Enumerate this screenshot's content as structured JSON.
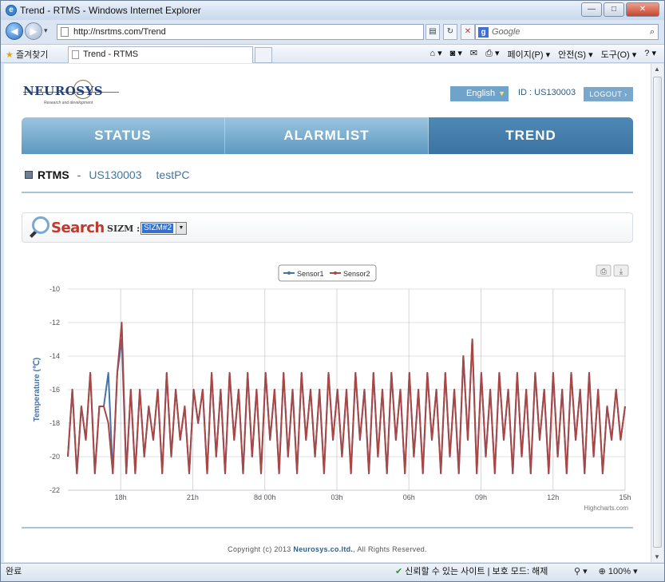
{
  "browser": {
    "title": "Trend - RTMS - Windows Internet Explorer",
    "url": "http://nsrtms.com/Trend",
    "search_placeholder": "Google",
    "favorites_label": "즐겨찾기",
    "tab_title": "Trend - RTMS",
    "commands": [
      "페이지(P) ▾",
      "안전(S) ▾",
      "도구(O) ▾"
    ],
    "status_left": "완료",
    "status_middle": "신뢰할 수 있는 사이트 | 보호 모드: 해제",
    "zoom": "100%"
  },
  "header": {
    "logo_text": "NEUROSYS",
    "logo_sub": "Research and development",
    "language": "English",
    "id_text": "ID : US130003",
    "logout_label": "LOGOUT"
  },
  "menu": {
    "items": [
      {
        "label": "STATUS",
        "active": false
      },
      {
        "label": "ALARMLIST",
        "active": false
      },
      {
        "label": "TREND",
        "active": true
      }
    ]
  },
  "breadcrumb": {
    "title": "RTMS",
    "sep": "-",
    "id": "US130003",
    "pc": "testPC"
  },
  "search": {
    "title": "Search",
    "sizm_label": "SIZM :",
    "sizm_value": "SIZM#2"
  },
  "footer": {
    "prefix": "Copyright (c) 2013 ",
    "company": "Neurosys.co.ltd.",
    "suffix": ", All Rights Reserved."
  },
  "chart_data": {
    "type": "line",
    "ylabel": "Temperature (℃)",
    "ylim": [
      -22,
      -10
    ],
    "yticks": [
      -10,
      -12,
      -14,
      -16,
      -18,
      -20,
      -22
    ],
    "xtick_labels": [
      "18h",
      "21h",
      "8d 00h",
      "03h",
      "06h",
      "09h",
      "12h",
      "15h"
    ],
    "xlim_hours": [
      15.8,
      39.0
    ],
    "xtick_hours": [
      18,
      21,
      24,
      27,
      30,
      33,
      36,
      39
    ],
    "credits": "Highcharts.com",
    "grid": "vertical",
    "legend_position": "top-center",
    "colors": {
      "Sensor1": "#4572a7",
      "Sensor2": "#aa4643"
    },
    "series": [
      {
        "name": "Sensor1",
        "values": [
          -20,
          -16,
          -21,
          -17,
          -19,
          -15,
          -21,
          -17,
          -17,
          -15,
          -21,
          -15,
          -13,
          -21,
          -16,
          -21,
          -16,
          -20,
          -17,
          -19,
          -16,
          -21,
          -15,
          -20,
          -16,
          -19,
          -17,
          -21,
          -16,
          -18,
          -16,
          -21,
          -15,
          -20,
          -16,
          -21,
          -15,
          -19,
          -16,
          -21,
          -15,
          -20,
          -16,
          -21,
          -15,
          -19,
          -16,
          -21,
          -15,
          -20,
          -16,
          -21,
          -15,
          -19,
          -16,
          -20,
          -16,
          -21,
          -15,
          -19,
          -16,
          -20,
          -16,
          -21,
          -15,
          -19,
          -16,
          -21,
          -15,
          -20,
          -16,
          -21,
          -15,
          -19,
          -16,
          -21,
          -15,
          -20,
          -16,
          -21,
          -15,
          -19,
          -16,
          -21,
          -15,
          -20,
          -16,
          -21,
          -14,
          -19,
          -13,
          -21,
          -15,
          -20,
          -16,
          -21,
          -15,
          -19,
          -16,
          -21,
          -15,
          -20,
          -16,
          -21,
          -15,
          -19,
          -16,
          -21,
          -15,
          -20,
          -16,
          -21,
          -15,
          -19,
          -16,
          -21,
          -15,
          -20,
          -16,
          -21,
          -17,
          -19,
          -16,
          -19,
          -17
        ]
      },
      {
        "name": "Sensor2",
        "values": [
          -20,
          -16,
          -21,
          -17,
          -19,
          -15,
          -21,
          -17,
          -17,
          -18,
          -21,
          -15,
          -12,
          -21,
          -16,
          -21,
          -16,
          -20,
          -17,
          -19,
          -16,
          -21,
          -15,
          -20,
          -16,
          -19,
          -17,
          -21,
          -16,
          -18,
          -16,
          -21,
          -15,
          -20,
          -16,
          -21,
          -15,
          -19,
          -16,
          -21,
          -15,
          -20,
          -16,
          -21,
          -15,
          -19,
          -16,
          -21,
          -15,
          -20,
          -16,
          -21,
          -15,
          -19,
          -16,
          -20,
          -16,
          -21,
          -15,
          -19,
          -16,
          -20,
          -16,
          -21,
          -15,
          -19,
          -16,
          -21,
          -15,
          -20,
          -16,
          -21,
          -15,
          -19,
          -16,
          -21,
          -15,
          -20,
          -16,
          -21,
          -15,
          -19,
          -16,
          -21,
          -15,
          -20,
          -16,
          -21,
          -14,
          -19,
          -13,
          -21,
          -15,
          -20,
          -16,
          -21,
          -15,
          -19,
          -16,
          -21,
          -15,
          -20,
          -16,
          -21,
          -15,
          -19,
          -16,
          -21,
          -15,
          -20,
          -16,
          -21,
          -15,
          -19,
          -16,
          -21,
          -15,
          -20,
          -16,
          -21,
          -17,
          -19,
          -16,
          -19,
          -17
        ]
      }
    ]
  }
}
